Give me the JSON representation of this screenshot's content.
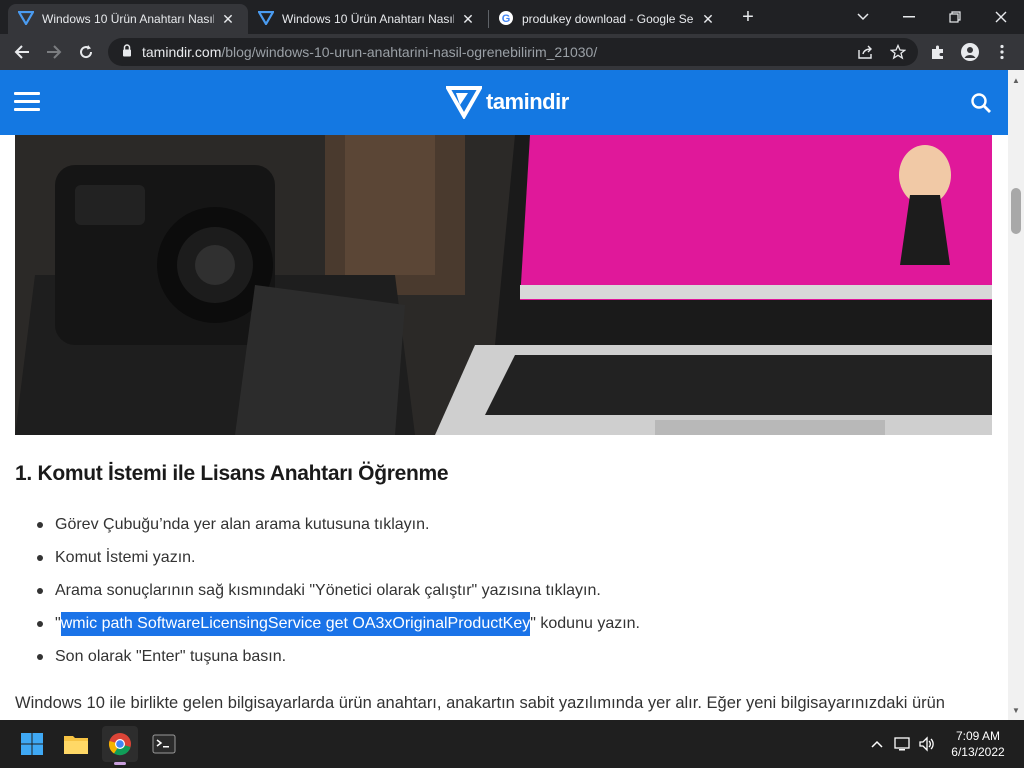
{
  "tabs": [
    {
      "title": "Windows 10 Ürün Anahtarı Nasıl",
      "active": true,
      "favicon": "tamindir-icon"
    },
    {
      "title": "Windows 10 Ürün Anahtarı Nasıl",
      "active": false,
      "favicon": "tamindir-icon"
    },
    {
      "title": "produkey download - Google Se",
      "active": false,
      "favicon": "google-icon"
    }
  ],
  "address": {
    "host": "tamindir.com",
    "path": "/blog/windows-10-urun-anahtarini-nasil-ogrenebilirim_21030/"
  },
  "site": {
    "logo_text": "tamindir",
    "brand_color": "#1478e2"
  },
  "article": {
    "heading": "1. Komut İstemi ile Lisans Anahtarı Öğrenme",
    "steps": [
      "Görev Çubuğu’nda yer alan arama kutusuna tıklayın.",
      "Komut İstemi yazın.",
      "Arama sonuçlarının sağ kısmındaki \"Yönetici olarak çalıştır\" yazısına tıklayın."
    ],
    "step4": {
      "open_quote": "\"",
      "selected": "wmic path SoftwareLicensingService get OA3xOriginalProductKey",
      "rest": "\" kodunu yazın."
    },
    "step5": "Son olarak \"Enter\" tuşuna basın.",
    "paragraph": "Windows 10 ile birlikte gelen bilgisayarlarda ürün anahtarı, anakartın sabit yazılımında yer alır. Eğer yeni bilgisayarınızdaki ürün"
  },
  "taskbar": {
    "apps": [
      "windows-start-icon",
      "file-explorer-icon",
      "chrome-icon",
      "terminal-icon"
    ],
    "time": "7:09 AM",
    "date": "6/13/2022"
  }
}
